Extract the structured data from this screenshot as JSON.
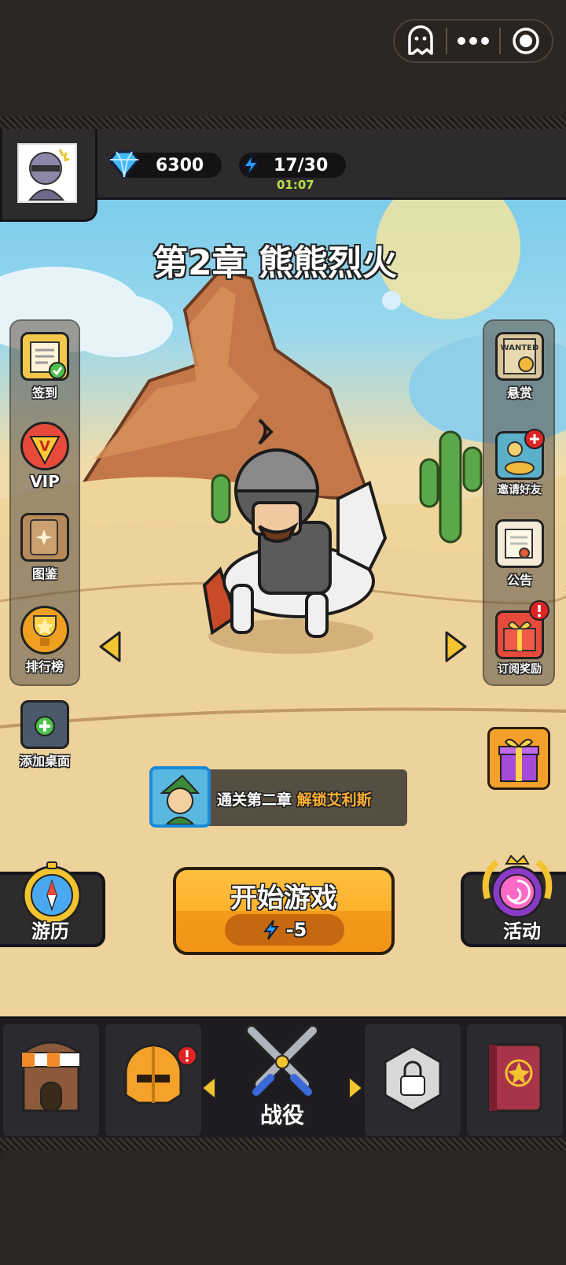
{
  "system": {
    "capsule_icons": [
      "ghost-icon",
      "more-dots-icon",
      "record-target-icon"
    ]
  },
  "header": {
    "gems": "6300",
    "energy": "17/30",
    "energy_timer": "01:07"
  },
  "chapter_title": "第2章 熊熊烈火",
  "left_menu": [
    {
      "label": "签到",
      "icon": "checkin-clipboard-icon"
    },
    {
      "label": "VIP",
      "icon": "vip-badge-icon"
    },
    {
      "label": "图鉴",
      "icon": "codex-book-icon"
    },
    {
      "label": "排行榜",
      "icon": "trophy-icon"
    }
  ],
  "add_desktop": "添加桌面",
  "right_menu": [
    {
      "label": "悬赏",
      "icon": "wanted-poster-icon"
    },
    {
      "label": "邀请好友",
      "icon": "invite-friends-icon"
    },
    {
      "label": "公告",
      "icon": "announcement-scroll-icon"
    },
    {
      "label": "订阅奖励",
      "icon": "subscription-gift-icon"
    }
  ],
  "unlock_hint": {
    "prefix": "通关第二章",
    "highlight": "解锁艾利斯"
  },
  "start_button": {
    "label": "开始游戏",
    "cost": "-5"
  },
  "travel_label": "游历",
  "event_label": "活动",
  "bottom_nav": {
    "active_label": "战役",
    "items": [
      "shop-icon",
      "helmet-equipment-icon",
      "crossed-swords-icon",
      "locked-hexagon-icon",
      "spellbook-icon"
    ]
  },
  "colors": {
    "accent_orange": "#f5a623",
    "highlight_text": "#ffb030",
    "energy_green": "#b8e04a",
    "badge_red": "#e02424"
  }
}
